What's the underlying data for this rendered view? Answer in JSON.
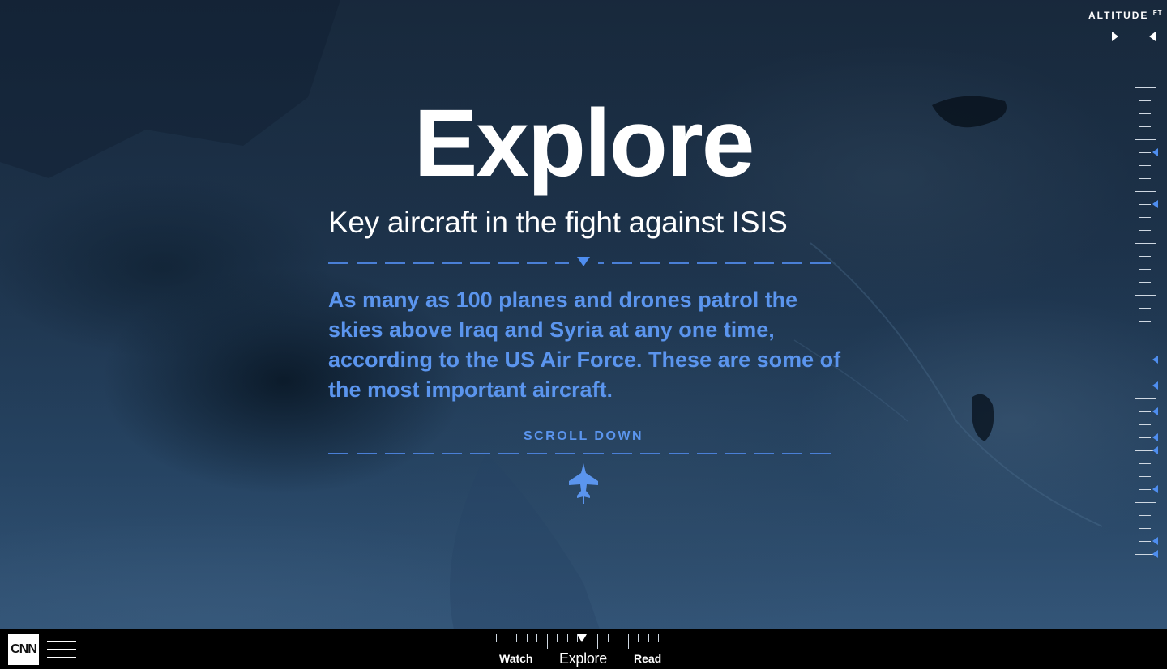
{
  "hero": {
    "title": "Explore",
    "subtitle": "Key aircraft in the fight against ISIS",
    "body": "As many as 100 planes and drones patrol the skies above Iraq and Syria at any one time, according to the US Air Force. These are some of the most important aircraft.",
    "scroll_label": "SCROLL DOWN"
  },
  "altitude": {
    "label": "ALTITUDE",
    "unit": "FT"
  },
  "footer": {
    "logo_text": "CNN",
    "nav": [
      {
        "label": "Watch"
      },
      {
        "label": "Explore",
        "active": true
      },
      {
        "label": "Read"
      }
    ]
  },
  "colors": {
    "accent": "#4f8ef0",
    "text": "#ffffff",
    "footer_bg": "#000000"
  },
  "icons": [
    "fighter-jet-icon",
    "menu-icon",
    "triangle-down-icon",
    "altitude-marker-icon"
  ]
}
